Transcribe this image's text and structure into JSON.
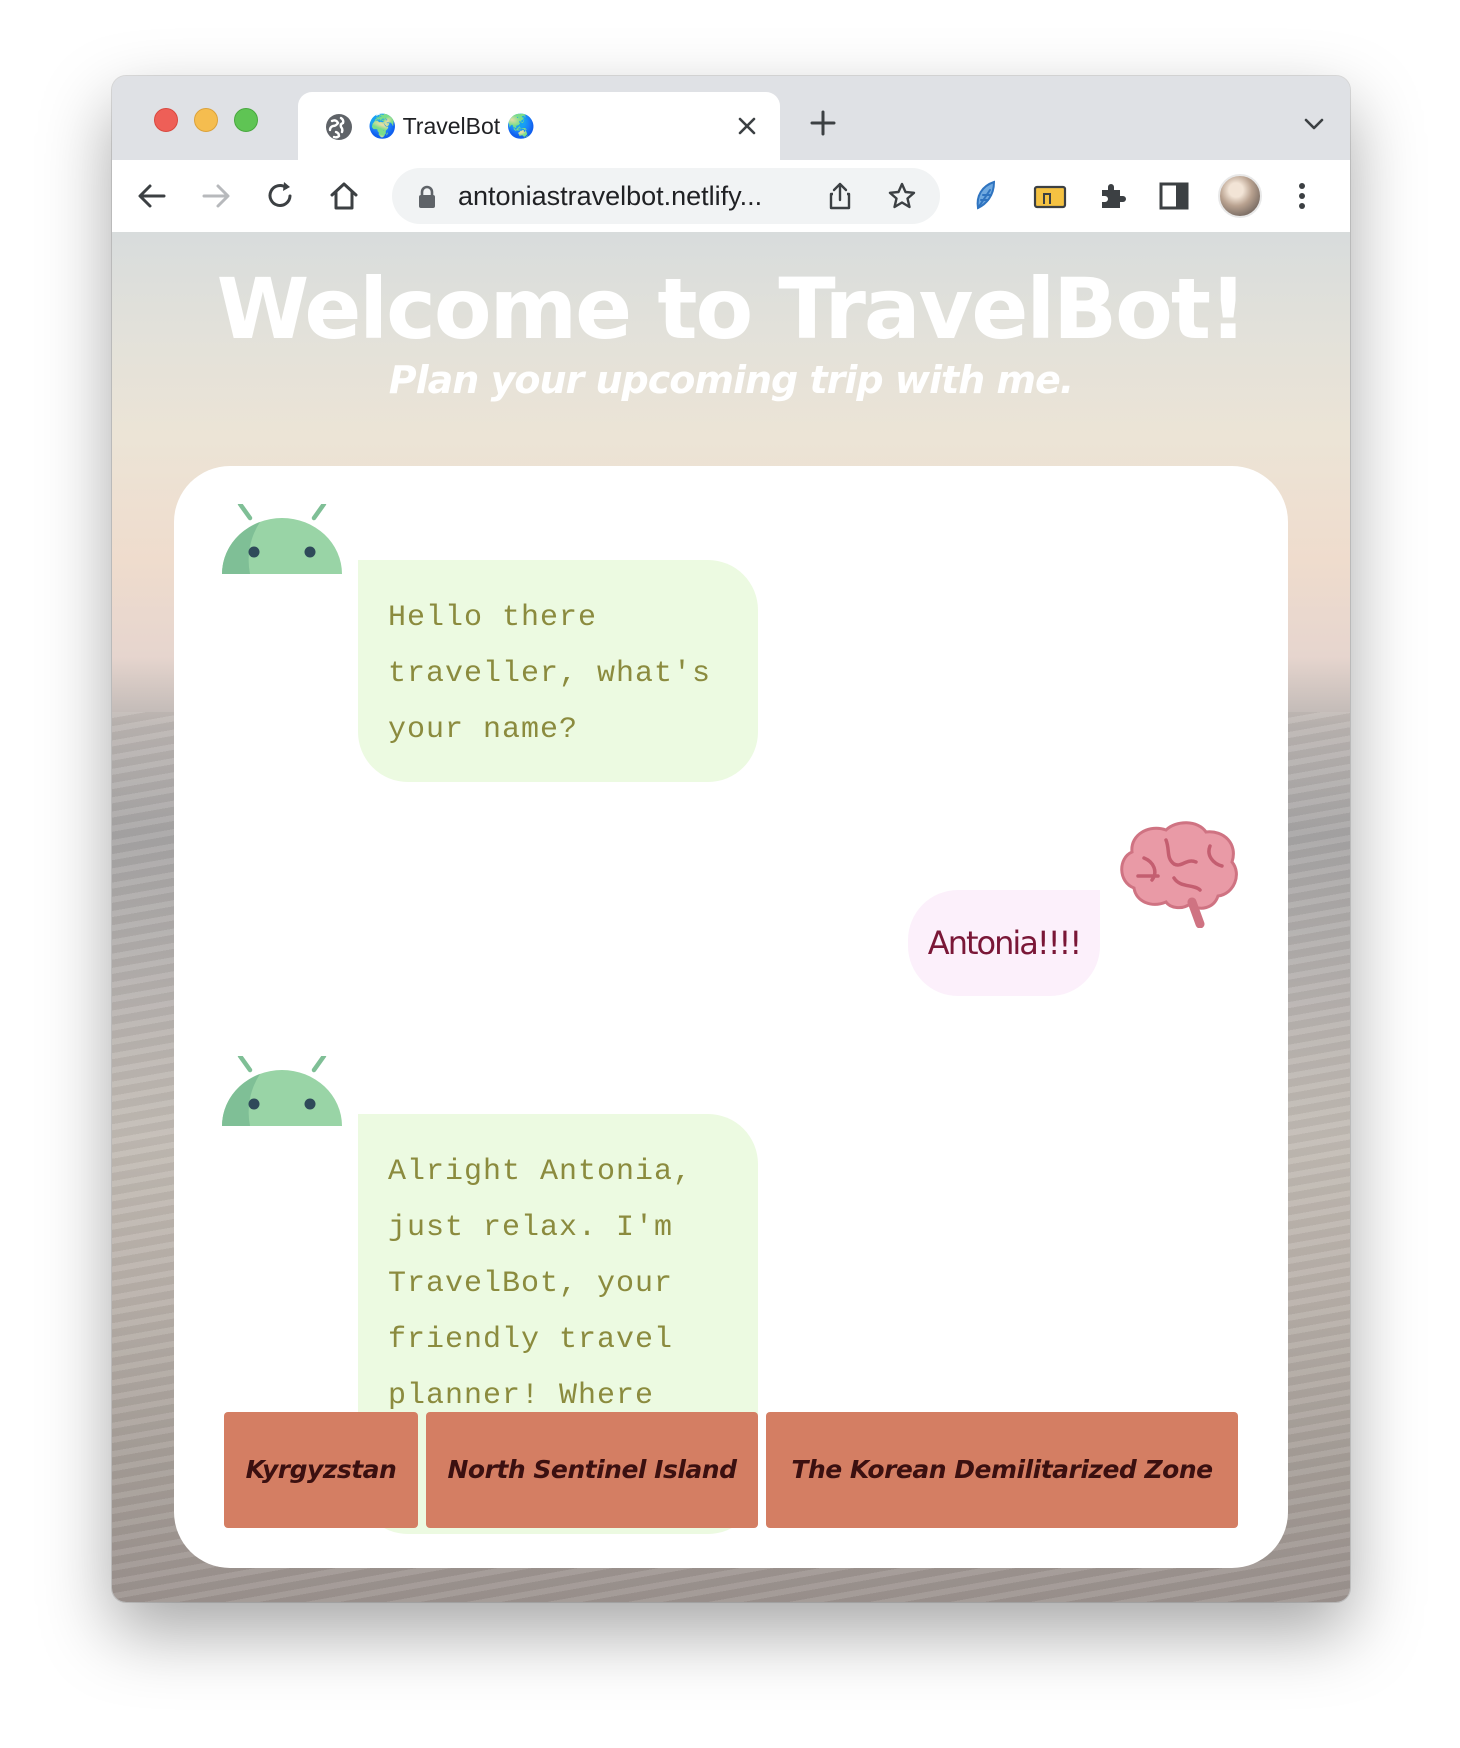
{
  "browser": {
    "tab_title": "🌍 TravelBot 🌏",
    "url": "antoniastravelbot.netlify..."
  },
  "page": {
    "title": "Welcome to TravelBot!",
    "subtitle": "Plan your upcoming trip with me."
  },
  "chat": {
    "messages": [
      {
        "sender": "bot",
        "text": "Hello there traveller, what's your name?"
      },
      {
        "sender": "user",
        "text": "Antonia!!!!"
      },
      {
        "sender": "bot",
        "text": "Alright Antonia, just relax. I'm TravelBot, your friendly travel planner! Where"
      }
    ],
    "options": [
      "Kyrgyzstan",
      "North Sentinel Island",
      "The Korean Demilitarized Zone"
    ]
  },
  "icons": {
    "bot_avatar": "android-robot-icon",
    "user_avatar": "brain-icon"
  },
  "colors": {
    "bot_bubble": "#ecfae1",
    "bot_text": "#8b8b3e",
    "user_bubble": "#fcf0fb",
    "user_text": "#7a1737",
    "option_button": "#d47e63"
  }
}
